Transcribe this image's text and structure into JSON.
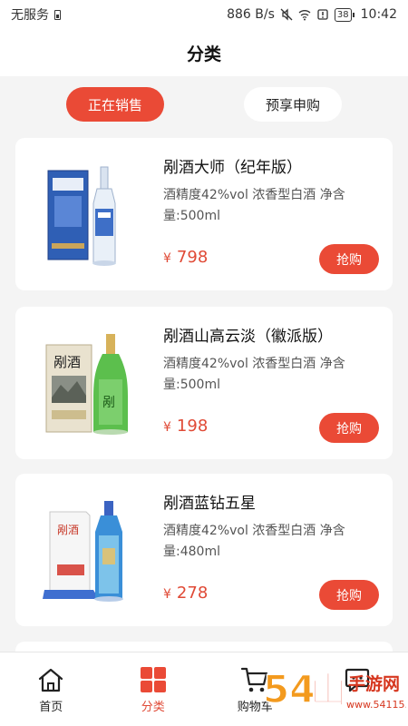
{
  "status_bar": {
    "carrier": "无服务",
    "speed": "886 B/s",
    "battery": "38",
    "time": "10:42"
  },
  "header": {
    "title": "分类"
  },
  "tabs": [
    {
      "label": "正在销售",
      "active": true
    },
    {
      "label": "预享申购",
      "active": false
    }
  ],
  "products": [
    {
      "name": "剐酒大师（纪年版）",
      "desc": "酒精度42%vol 浓香型白酒  净含量:500ml",
      "currency": "¥",
      "price": "798",
      "buy_label": "抢购"
    },
    {
      "name": "剐酒山高云淡（徽派版）",
      "desc": "酒精度42%vol 浓香型白酒  净含量:500ml",
      "currency": "¥",
      "price": "198",
      "buy_label": "抢购"
    },
    {
      "name": "剐酒蓝钻五星",
      "desc": "酒精度42%vol 浓香型白酒  净含量:480ml",
      "currency": "¥",
      "price": "278",
      "buy_label": "抢购"
    }
  ],
  "tabbar": [
    {
      "label": "首页",
      "icon": "home-icon",
      "active": false
    },
    {
      "label": "分类",
      "icon": "category-grid-icon",
      "active": true
    },
    {
      "label": "购物车",
      "icon": "cart-icon",
      "active": false
    },
    {
      "label": "",
      "icon": "profile-icon",
      "active": false
    }
  ],
  "watermark": {
    "text": "54山手游网",
    "domain": "www.54115.cn"
  },
  "colors": {
    "accent": "#ea4a36",
    "price": "#e04a36",
    "background": "#f4f4f4"
  }
}
